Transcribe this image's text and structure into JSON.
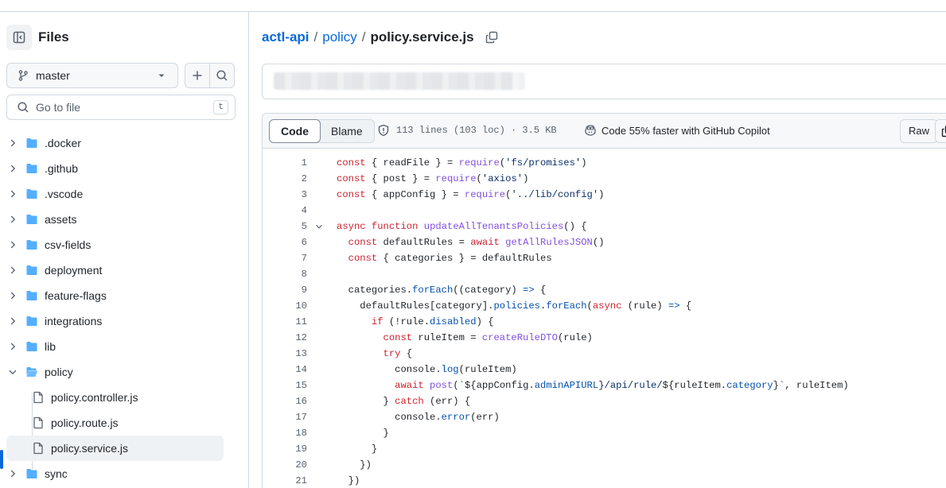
{
  "sidebar": {
    "title": "Files",
    "branch": "master",
    "goto_placeholder": "Go to file",
    "goto_shortcut": "t",
    "tree": [
      {
        "label": ".docker",
        "type": "folder",
        "expanded": false
      },
      {
        "label": ".github",
        "type": "folder",
        "expanded": false
      },
      {
        "label": ".vscode",
        "type": "folder",
        "expanded": false
      },
      {
        "label": "assets",
        "type": "folder",
        "expanded": false
      },
      {
        "label": "csv-fields",
        "type": "folder",
        "expanded": false
      },
      {
        "label": "deployment",
        "type": "folder",
        "expanded": false
      },
      {
        "label": "feature-flags",
        "type": "folder",
        "expanded": false
      },
      {
        "label": "integrations",
        "type": "folder",
        "expanded": false
      },
      {
        "label": "lib",
        "type": "folder",
        "expanded": false
      },
      {
        "label": "policy",
        "type": "folder",
        "expanded": true
      },
      {
        "label": "policy.controller.js",
        "type": "file"
      },
      {
        "label": "policy.route.js",
        "type": "file"
      },
      {
        "label": "policy.service.js",
        "type": "file",
        "selected": true
      },
      {
        "label": "sync",
        "type": "folder",
        "expanded": false
      }
    ]
  },
  "breadcrumb": {
    "repo": "actl-api",
    "sep1": "/",
    "folder": "policy",
    "sep2": "/",
    "file": "policy.service.js"
  },
  "file_header": {
    "tabs": [
      "Code",
      "Blame"
    ],
    "active_tab": "Code",
    "info": "113 lines (103 loc) · 3.5 KB",
    "copilot": "Code 55% faster with GitHub Copilot",
    "raw_label": "Raw"
  },
  "code_lines": [
    {
      "n": "1",
      "text": "const { readFile } = require('fs/promises')"
    },
    {
      "n": "2",
      "text": "const { post } = require('axios')"
    },
    {
      "n": "3",
      "text": "const { appConfig } = require('../lib/config')"
    },
    {
      "n": "4",
      "text": ""
    },
    {
      "n": "5",
      "text": "async function updateAllTenantsPolicies() {"
    },
    {
      "n": "6",
      "text": "  const defaultRules = await getAllRulesJSON()"
    },
    {
      "n": "7",
      "text": "  const { categories } = defaultRules"
    },
    {
      "n": "8",
      "text": ""
    },
    {
      "n": "9",
      "text": "  categories.forEach((category) => {"
    },
    {
      "n": "10",
      "text": "    defaultRules[category].policies.forEach(async (rule) => {"
    },
    {
      "n": "11",
      "text": "      if (!rule.disabled) {"
    },
    {
      "n": "12",
      "text": "        const ruleItem = createRuleDTO(rule)"
    },
    {
      "n": "13",
      "text": "        try {"
    },
    {
      "n": "14",
      "text": "          console.log(ruleItem)"
    },
    {
      "n": "15",
      "text": "          await post(`${appConfig.adminAPIURL}/api/rule/${ruleItem.category}`, ruleItem)"
    },
    {
      "n": "16",
      "text": "        } catch (err) {"
    },
    {
      "n": "17",
      "text": "          console.error(err)"
    },
    {
      "n": "18",
      "text": "        }"
    },
    {
      "n": "19",
      "text": "      }"
    },
    {
      "n": "20",
      "text": "    })"
    },
    {
      "n": "21",
      "text": "  })"
    }
  ],
  "colors": {
    "link": "#0969da",
    "keyword": "#cf222e",
    "function": "#8250df",
    "string": "#0a3069",
    "property": "#0550ae",
    "folder": "#54aeff"
  }
}
